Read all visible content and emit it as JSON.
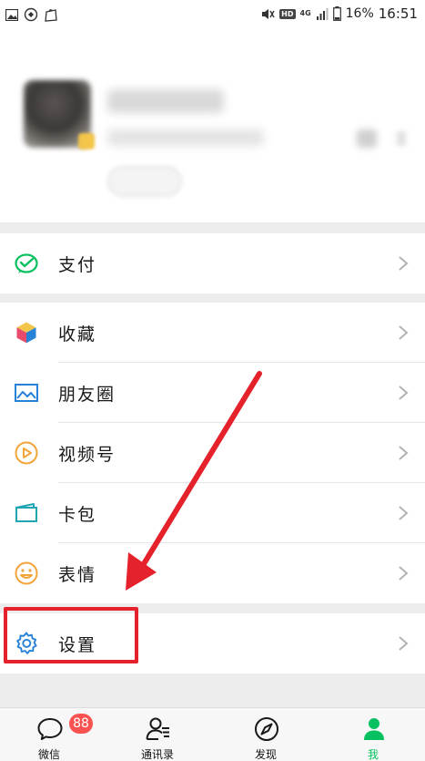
{
  "status_bar": {
    "time": "16:51",
    "battery": "16%",
    "network_type": "4G",
    "hd": "HD",
    "icons_left": [
      "gallery-icon",
      "sync-icon",
      "bag-icon"
    ],
    "icons_right": [
      "mute-icon",
      "hd-icon",
      "signal-icon",
      "battery-icon"
    ]
  },
  "menu": {
    "pay": {
      "label": "支付",
      "icon": "wechat-pay-icon",
      "color": "#07c160"
    },
    "favorites": {
      "label": "收藏",
      "icon": "cube-icon",
      "color": "#f3a43b"
    },
    "moments": {
      "label": "朋友圈",
      "icon": "image-icon",
      "color": "#2782d7"
    },
    "channels": {
      "label": "视频号",
      "icon": "play-circle-icon",
      "color": "#f3a43b"
    },
    "cards": {
      "label": "卡包",
      "icon": "card-icon",
      "color": "#20a5b4"
    },
    "stickers": {
      "label": "表情",
      "icon": "smile-icon",
      "color": "#f3a43b"
    },
    "settings": {
      "label": "设置",
      "icon": "gear-icon",
      "color": "#2782d7"
    }
  },
  "tabs": [
    {
      "label": "微信",
      "badge": "88",
      "icon": "chat-bubble-icon"
    },
    {
      "label": "通讯录",
      "icon": "contacts-icon"
    },
    {
      "label": "发现",
      "icon": "compass-icon"
    },
    {
      "label": "我",
      "icon": "person-icon",
      "active": true
    }
  ],
  "colors": {
    "accent": "#07c160",
    "annotation": "#e5222b",
    "badge": "#fa5151"
  }
}
